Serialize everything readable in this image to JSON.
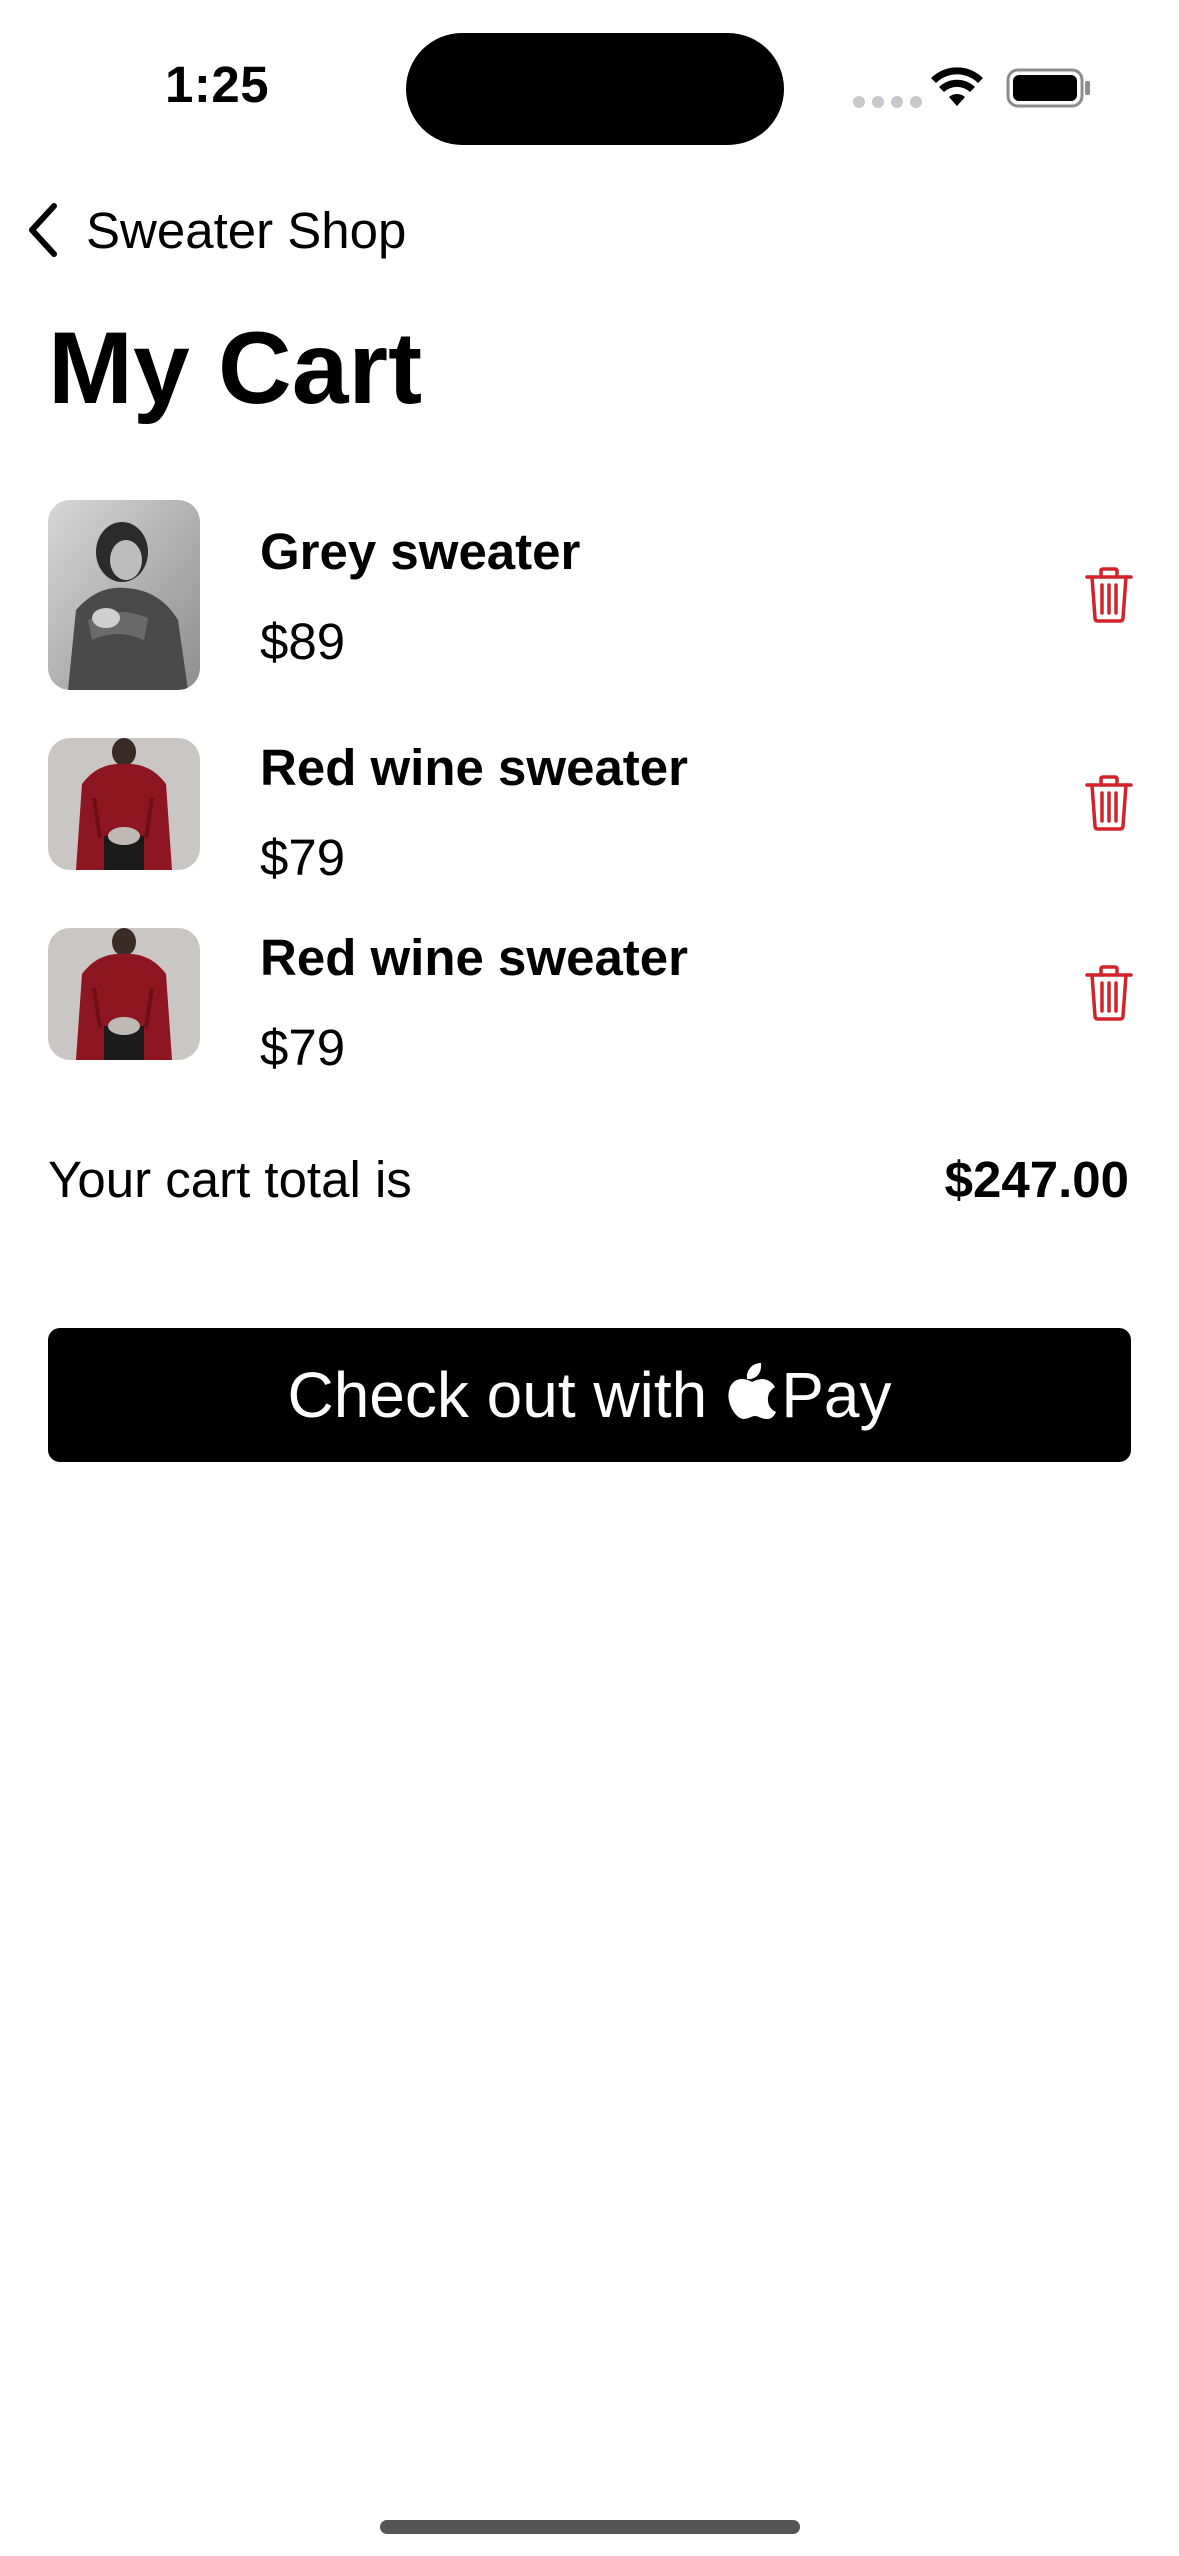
{
  "status_bar": {
    "time": "1:25",
    "icons": [
      "signal-dots-icon",
      "wifi-icon",
      "battery-icon"
    ]
  },
  "nav": {
    "back_label": "Sweater Shop",
    "back_icon": "chevron-left-icon"
  },
  "page": {
    "title": "My Cart"
  },
  "cart": {
    "items": [
      {
        "name": "Grey sweater",
        "price": "$89",
        "image": "grey-sweater-photo"
      },
      {
        "name": "Red wine sweater",
        "price": "$79",
        "image": "red-wine-sweater-photo"
      },
      {
        "name": "Red wine sweater",
        "price": "$79",
        "image": "red-wine-sweater-photo"
      }
    ],
    "delete_icon": "trash-icon",
    "total_label": "Your cart total is",
    "total_value": "$247.00"
  },
  "checkout": {
    "label": "Check out with",
    "pay_label": "Pay",
    "icon": "apple-logo-icon"
  },
  "colors": {
    "accent_red": "#d0232a",
    "button_bg": "#000000"
  }
}
